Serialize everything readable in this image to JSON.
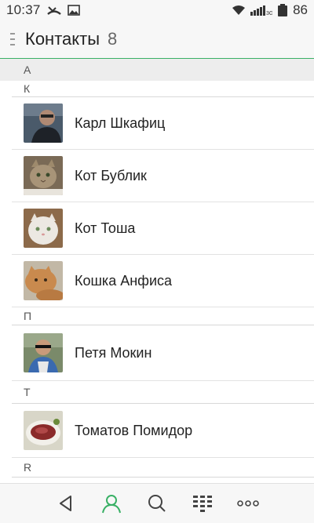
{
  "status_bar": {
    "time": "10:37",
    "battery": "86",
    "icons": [
      "missed-call-icon",
      "image-icon",
      "wifi-icon",
      "signal-3g-icon"
    ]
  },
  "header": {
    "title": "Контакты",
    "count": "8"
  },
  "sections": [
    {
      "letter": "А",
      "contacts": []
    },
    {
      "letter": "К",
      "contacts": [
        {
          "name": "Карл Шкафиц",
          "avatar": "man-portrait"
        },
        {
          "name": "Кот Бублик",
          "avatar": "tabby-cat"
        },
        {
          "name": "Кот Тоша",
          "avatar": "white-cat"
        },
        {
          "name": "Кошка Анфиса",
          "avatar": "orange-cat"
        }
      ]
    },
    {
      "letter": "П",
      "contacts": [
        {
          "name": "Петя Мокин",
          "avatar": "man-sunglasses"
        }
      ]
    },
    {
      "letter": "Т",
      "contacts": [
        {
          "name": "Томатов Помидор",
          "avatar": "food-plate"
        }
      ]
    },
    {
      "letter": "R",
      "contacts": []
    }
  ],
  "bottom_nav": {
    "items": [
      "back-icon",
      "contacts-icon",
      "search-icon",
      "dialpad-icon",
      "more-icon"
    ]
  },
  "colors": {
    "accent": "#39b065",
    "divider": "#d8d8d8"
  }
}
